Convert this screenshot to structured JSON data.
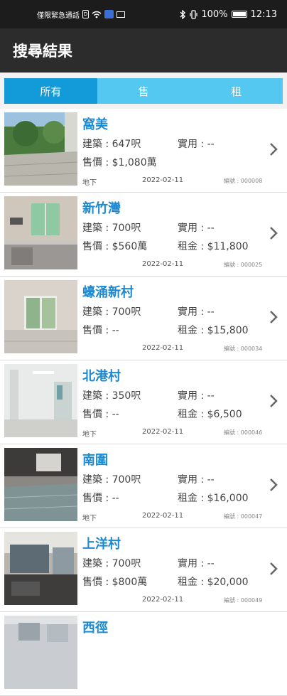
{
  "status_bar": {
    "carrier": "僅限緊急通話",
    "sim_label": "D",
    "battery": "100%",
    "time": "12:13"
  },
  "app": {
    "title": "搜尋結果"
  },
  "tabs": [
    {
      "label": "所有",
      "active": true
    },
    {
      "label": "售",
      "active": false
    },
    {
      "label": "租",
      "active": false
    }
  ],
  "listings": [
    {
      "name": "窩美",
      "build": "建築 : 647呎",
      "use": "實用 : --",
      "sale": "售價 : $1,080萬",
      "rent": "",
      "location": "地下",
      "date": "2022-02-11",
      "ref": "編號 : 000008"
    },
    {
      "name": "新竹灣",
      "build": "建築 : 700呎",
      "use": "實用 : --",
      "sale": "售價 : $560萬",
      "rent": "租金 : $11,800",
      "location": "",
      "date": "2022-02-11",
      "ref": "編號 : 000025"
    },
    {
      "name": "蠔涌新村",
      "build": "建築 : 700呎",
      "use": "實用 : --",
      "sale": "售價 : --",
      "rent": "租金 : $15,800",
      "location": "",
      "date": "2022-02-11",
      "ref": "編號 : 000034"
    },
    {
      "name": "北港村",
      "build": "建築 : 350呎",
      "use": "實用 : --",
      "sale": "售價 : --",
      "rent": "租金 : $6,500",
      "location": "地下",
      "date": "2022-02-11",
      "ref": "編號 : 000046"
    },
    {
      "name": "南圍",
      "build": "建築 : 700呎",
      "use": "實用 : --",
      "sale": "售價 : --",
      "rent": "租金 : $16,000",
      "location": "地下",
      "date": "2022-02-11",
      "ref": "編號 : 000047"
    },
    {
      "name": "上洋村",
      "build": "建築 : 700呎",
      "use": "實用 : --",
      "sale": "售價 : $800萬",
      "rent": "租金 : $20,000",
      "location": "",
      "date": "2022-02-11",
      "ref": "編號 : 000049"
    },
    {
      "name": "西徑",
      "build": "",
      "use": "",
      "sale": "",
      "rent": "",
      "location": "",
      "date": "",
      "ref": ""
    }
  ]
}
